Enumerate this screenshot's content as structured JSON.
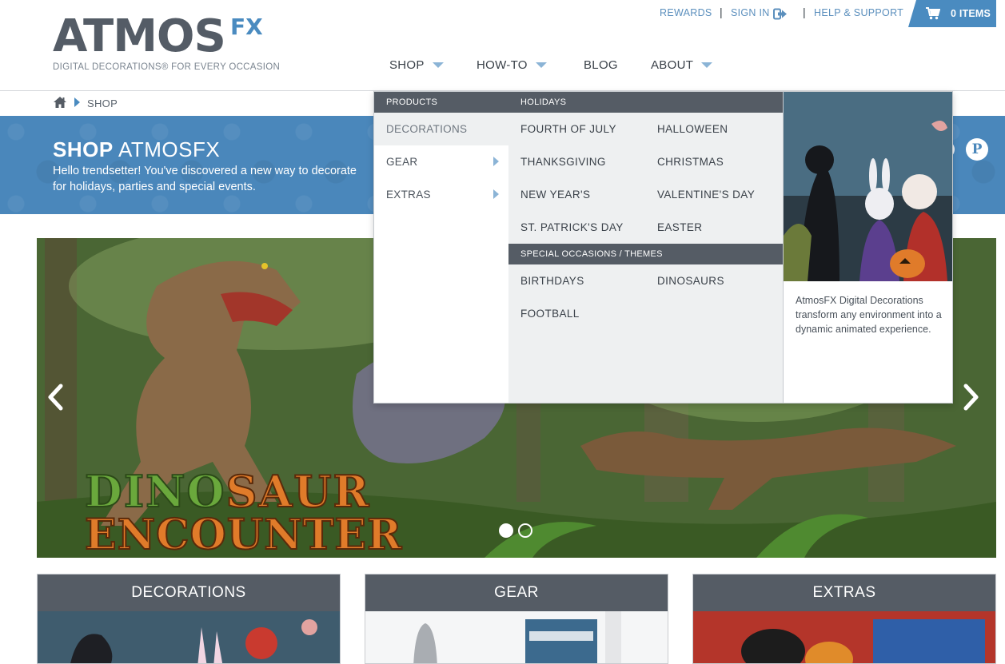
{
  "header": {
    "logo_main": "ATMOS",
    "logo_fx": "FX",
    "logo_tagline": "DIGITAL DECORATIONS® FOR EVERY OCCASION",
    "utility": {
      "rewards": "REWARDS",
      "sign_in": "SIGN IN",
      "help": "HELP & SUPPORT",
      "cart": "0 ITEMS",
      "separator": "|"
    },
    "nav": [
      {
        "label": "SHOP",
        "dropdown": true
      },
      {
        "label": "HOW-TO",
        "dropdown": true
      },
      {
        "label": "BLOG",
        "dropdown": false
      },
      {
        "label": "ABOUT",
        "dropdown": true
      }
    ]
  },
  "breadcrumb": {
    "current": "SHOP"
  },
  "banner": {
    "title_bold": "SHOP",
    "title_rest": "ATMOSFX",
    "subtitle": "Hello trendsetter! You've discovered a new way to decorate for holidays, parties and special events.",
    "pinterest_glyph": "P"
  },
  "hero": {
    "title_line1_a": "DINO",
    "title_line1_b": "SAUR",
    "title_line2": "ENCOUNTER",
    "slide_count": 2,
    "active_slide": 1
  },
  "cards": [
    {
      "label": "DECORATIONS"
    },
    {
      "label": "GEAR"
    },
    {
      "label": "EXTRAS"
    }
  ],
  "mega_menu": {
    "products_heading": "PRODUCTS",
    "products": [
      {
        "label": "DECORATIONS",
        "active": true,
        "has_submenu": false
      },
      {
        "label": "GEAR",
        "active": false,
        "has_submenu": true
      },
      {
        "label": "EXTRAS",
        "active": false,
        "has_submenu": true
      }
    ],
    "holidays_heading": "HOLIDAYS",
    "holidays": [
      "FOURTH OF JULY",
      "HALLOWEEN",
      "THANKSGIVING",
      "CHRISTMAS",
      "NEW YEAR'S",
      "VALENTINE'S DAY",
      "ST. PATRICK'S DAY",
      "EASTER"
    ],
    "occasions_heading": "SPECIAL OCCASIONS / THEMES",
    "occasions": [
      "BIRTHDAYS",
      "DINOSAURS",
      "FOOTBALL"
    ],
    "feature_text": "AtmosFX Digital Decorations transform any environment into a dynamic animated experience."
  },
  "colors": {
    "brand_blue": "#4a8bc0",
    "dark_gray": "#555c65",
    "menu_panel": "#eef0f1"
  },
  "icons": [
    "home-icon",
    "sign-in-icon",
    "cart-icon",
    "pinterest-icon",
    "chevron-left-icon",
    "chevron-right-icon"
  ]
}
